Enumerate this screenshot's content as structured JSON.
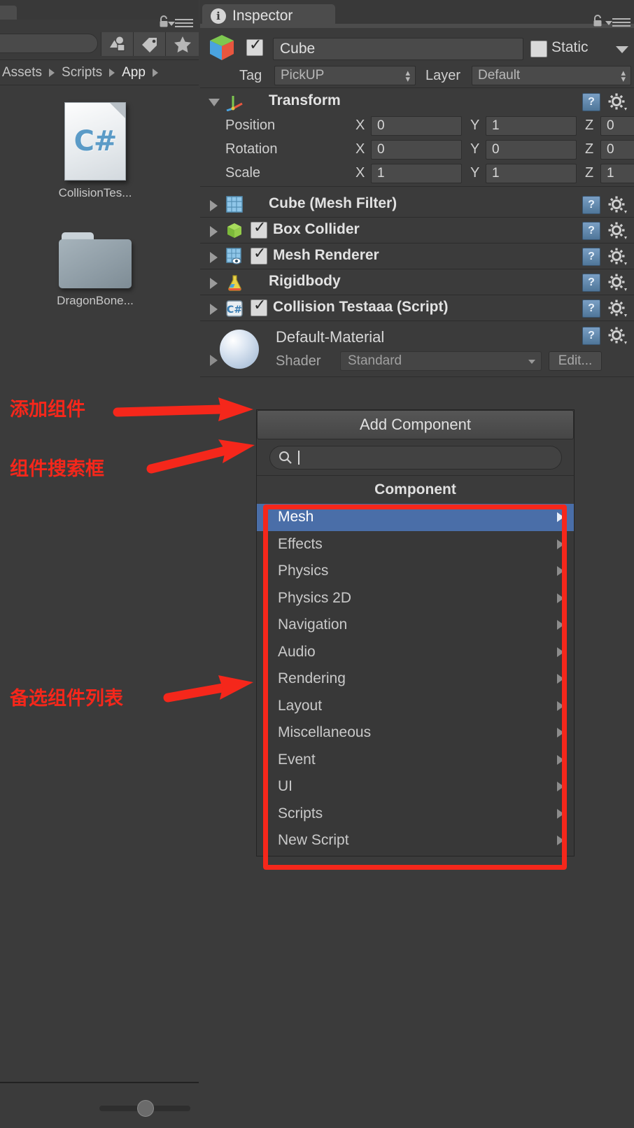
{
  "project_panel": {
    "search_placeholder": "",
    "search_value": "",
    "filter_buttons": [
      {
        "name": "type-filter-icon",
        "glyph": "type"
      },
      {
        "name": "label-filter-icon",
        "glyph": "tag"
      },
      {
        "name": "favorites-filter-icon",
        "glyph": "star"
      }
    ],
    "breadcrumb": [
      "Assets",
      "Scripts",
      "App"
    ],
    "assets": [
      {
        "label": "CollisionTes...",
        "icon": "csharp-script-icon",
        "badge": "C#"
      },
      {
        "label": "DragonBone...",
        "icon": "folder-icon"
      }
    ],
    "lock_icon": "lock-icon",
    "menu_icon": "panel-menu-icon",
    "zoom_slider_value": 42
  },
  "inspector": {
    "tab_label": "Inspector",
    "tab_icon": "info-icon",
    "lock_icon": "lock-icon",
    "menu_icon": "panel-menu-icon",
    "game_object": {
      "icon": "cube-gameobject-icon",
      "enabled": true,
      "name": "Cube",
      "static_label": "Static",
      "static_checked": false,
      "tag_label": "Tag",
      "tag_value": "PickUP",
      "layer_label": "Layer",
      "layer_value": "Default"
    },
    "transform": {
      "title": "Transform",
      "icon": "transform-axis-icon",
      "expanded": true,
      "rows": [
        {
          "label": "Position",
          "x": "0",
          "y": "1",
          "z": "0"
        },
        {
          "label": "Rotation",
          "x": "0",
          "y": "0",
          "z": "0"
        },
        {
          "label": "Scale",
          "x": "1",
          "y": "1",
          "z": "1"
        }
      ],
      "axes": [
        "X",
        "Y",
        "Z"
      ]
    },
    "components": [
      {
        "title": "Cube (Mesh Filter)",
        "icon": "mesh-filter-icon",
        "has_checkbox": false,
        "checked": false
      },
      {
        "title": "Box Collider",
        "icon": "box-collider-icon",
        "has_checkbox": true,
        "checked": true
      },
      {
        "title": "Mesh Renderer",
        "icon": "mesh-renderer-icon",
        "has_checkbox": true,
        "checked": true
      },
      {
        "title": "Rigidbody",
        "icon": "rigidbody-icon",
        "has_checkbox": false,
        "checked": false
      },
      {
        "title": "Collision Testaaa (Script)",
        "icon": "csharp-component-icon",
        "has_checkbox": true,
        "checked": true
      }
    ],
    "material": {
      "name": "Default-Material",
      "shader_label": "Shader",
      "shader_value": "Standard",
      "edit_label": "Edit...",
      "preview_icon": "material-sphere-icon"
    },
    "help_icon": "help-book-icon",
    "gear_icon": "gear-icon"
  },
  "add_component": {
    "button_label": "Add Component",
    "search_icon": "search-icon",
    "search_value": "",
    "menu_title": "Component",
    "items": [
      {
        "label": "Mesh",
        "selected": true,
        "has_submenu": true
      },
      {
        "label": "Effects",
        "selected": false,
        "has_submenu": true
      },
      {
        "label": "Physics",
        "selected": false,
        "has_submenu": true
      },
      {
        "label": "Physics 2D",
        "selected": false,
        "has_submenu": true
      },
      {
        "label": "Navigation",
        "selected": false,
        "has_submenu": true
      },
      {
        "label": "Audio",
        "selected": false,
        "has_submenu": true
      },
      {
        "label": "Rendering",
        "selected": false,
        "has_submenu": true
      },
      {
        "label": "Layout",
        "selected": false,
        "has_submenu": true
      },
      {
        "label": "Miscellaneous",
        "selected": false,
        "has_submenu": true
      },
      {
        "label": "Event",
        "selected": false,
        "has_submenu": true
      },
      {
        "label": "UI",
        "selected": false,
        "has_submenu": true
      },
      {
        "label": "Scripts",
        "selected": false,
        "has_submenu": true
      },
      {
        "label": "New Script",
        "selected": false,
        "has_submenu": true
      }
    ]
  },
  "annotations": {
    "color": "#f5271b",
    "labels": [
      {
        "text": "添加组件",
        "target": "add-component-button"
      },
      {
        "text": "组件搜索框",
        "target": "component-search-box"
      },
      {
        "text": "备选组件列表",
        "target": "component-menu-list"
      }
    ]
  },
  "colors": {
    "panel_bg": "#3b3b3b",
    "menu_bg": "#383838",
    "selection_blue": "#4a6ea8",
    "annotation_red": "#f5271b",
    "text_primary": "#e0e0e0",
    "text_secondary": "#c9c9c9"
  }
}
